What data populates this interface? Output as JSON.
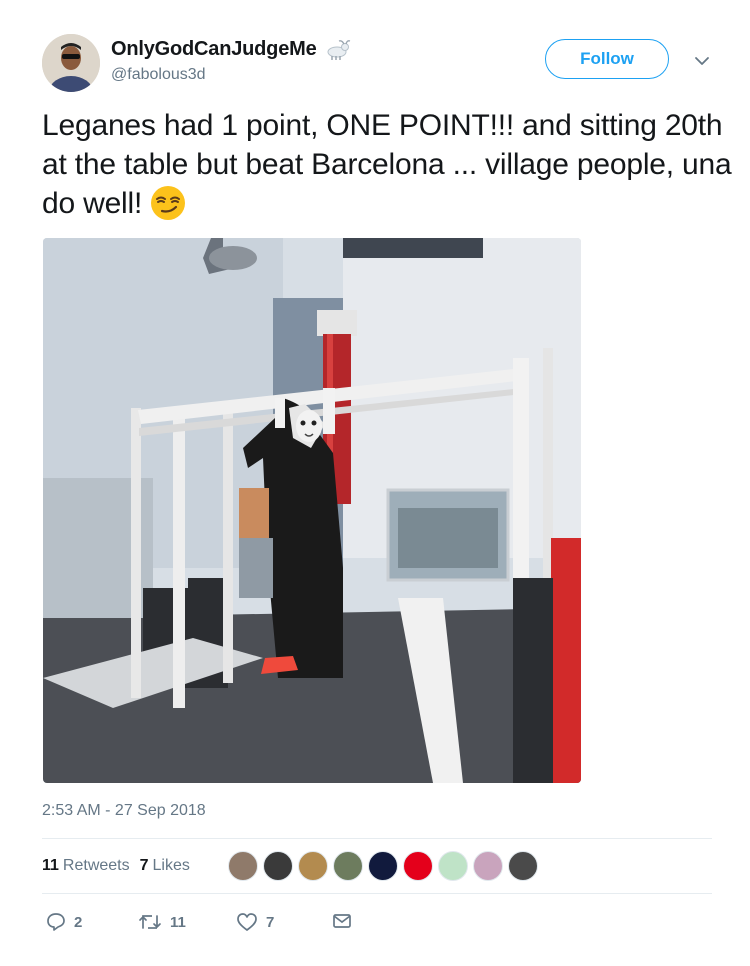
{
  "user": {
    "display_name": "OnlyGodCanJudgeMe",
    "handle": "@fabolous3d",
    "badge_icon": "goat-emoji-icon"
  },
  "follow_label": "Follow",
  "tweet": {
    "text": "Leganes had 1 point, ONE POINT!!!  and sitting 20th at the table but beat Barcelona ... village people, una do well!",
    "emoji": "smirking-face-emoji",
    "media_description_icon": "photo"
  },
  "timestamp": "2:53 AM - 27 Sep 2018",
  "stats": {
    "retweets_count": "11",
    "retweets_label": "Retweets",
    "likes_count": "7",
    "likes_label": "Likes"
  },
  "actions": {
    "reply_count": "2",
    "retweet_count": "11",
    "like_count": "7"
  },
  "colors": {
    "accent": "#1da1f2",
    "muted": "#657786",
    "text": "#14171a"
  }
}
